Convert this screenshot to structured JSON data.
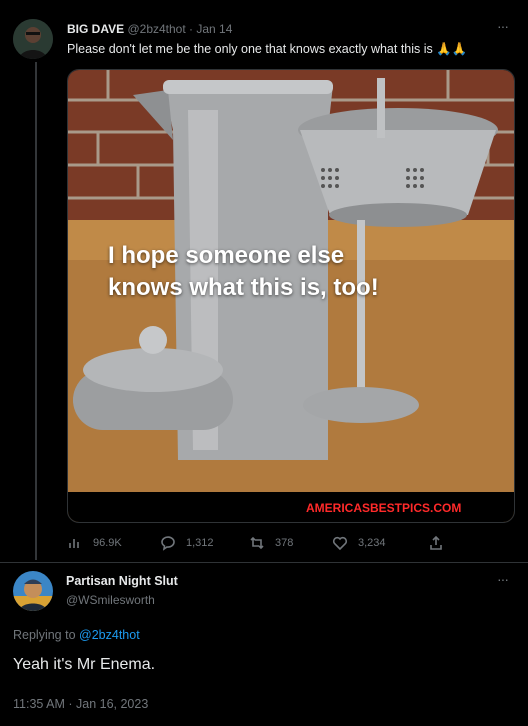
{
  "original_tweet": {
    "author_name": "BIG DAVE",
    "handle": "@2bz4thot",
    "separator": "·",
    "date": "Jan 14",
    "text": "Please don't let me be the only one that knows exactly what this is 🙏🙏",
    "image": {
      "overlay_text_line1": "I hope someone else",
      "overlay_text_line2": "knows what this is, too!",
      "watermark": "AMERICASBESTPICS.COM"
    },
    "stats": {
      "views": "96.9K",
      "replies": "1,312",
      "retweets": "378",
      "likes": "3,234"
    },
    "more_label": "···"
  },
  "reply_tweet": {
    "author_name": "Partisan Night Slut",
    "handle": "@WSmilesworth",
    "more_label": "···",
    "replying_prefix": "Replying to",
    "replying_handle": "@2bz4thot",
    "text": "Yeah it's Mr Enema.",
    "timestamp": "11:35 AM · Jan 16, 2023"
  },
  "icons": {
    "views": "bar-chart-icon",
    "replies": "speech-bubble-icon",
    "retweets": "retweet-icon",
    "likes": "heart-icon",
    "share": "share-icon"
  },
  "colors": {
    "background": "#000000",
    "text": "#e7e9ea",
    "muted": "#71767b",
    "link": "#1d9bf0",
    "watermark": "#ff2a2a"
  }
}
